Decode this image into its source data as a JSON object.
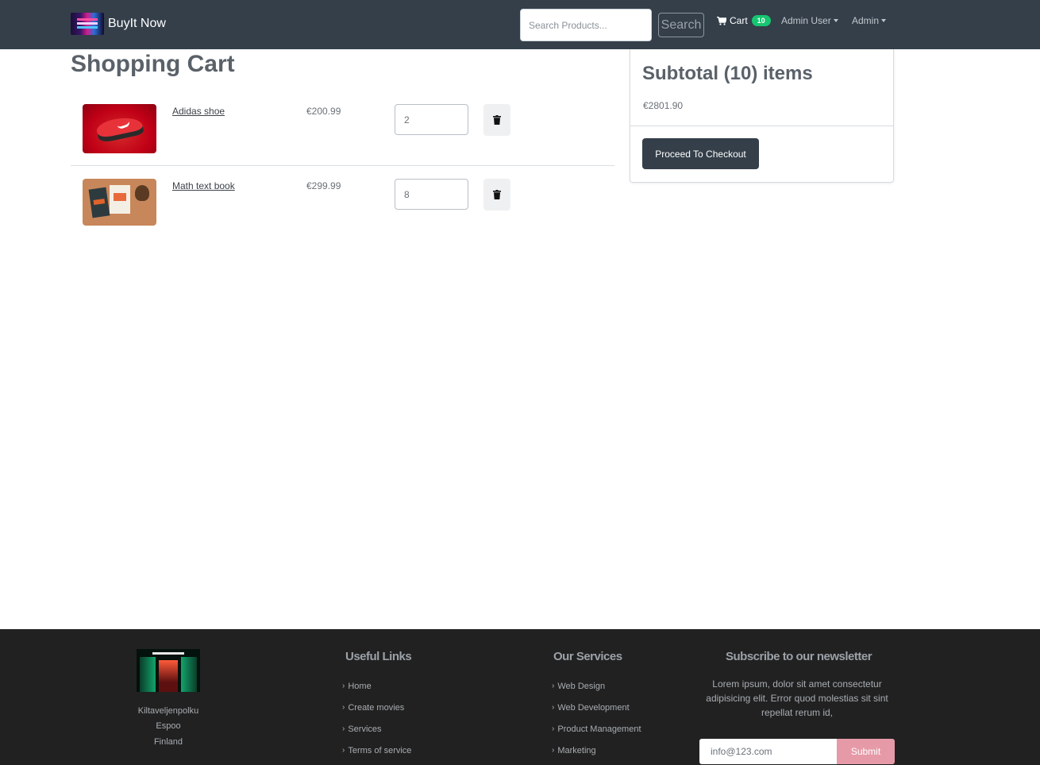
{
  "navbar": {
    "brand": "BuyIt Now",
    "search_placeholder": "Search Products...",
    "search_button": "Search",
    "cart_label": "Cart",
    "cart_count": "10",
    "user_menu": "Admin User",
    "admin_menu": "Admin"
  },
  "cart": {
    "title": "Shopping Cart",
    "items": [
      {
        "name": "Adidas shoe",
        "price": "€200.99",
        "quantity": "2",
        "image": "red-sneaker-photo"
      },
      {
        "name": "Math text book",
        "price": "€299.99",
        "quantity": "8",
        "image": "books-and-pinecone-photo"
      }
    ]
  },
  "summary": {
    "title": "Subtotal (10) items",
    "total": "€2801.90",
    "checkout_button": "Proceed To Checkout"
  },
  "footer": {
    "address": [
      "Kiltaveljenpolku",
      "Espoo",
      "Finland"
    ],
    "useful_links": {
      "heading": "Useful Links",
      "items": [
        "Home",
        "Create movies",
        "Services",
        "Terms of service"
      ]
    },
    "services": {
      "heading": "Our Services",
      "items": [
        "Web Design",
        "Web Development",
        "Product Management",
        "Marketing"
      ]
    },
    "newsletter": {
      "heading": "Subscribe to our newsletter",
      "text": "Lorem ipsum, dolor sit amet consectetur adipisicing elit. Error quod molestias sit sint repellat rerum id,",
      "email_value": "info@123.com",
      "submit": "Submit"
    }
  },
  "colors": {
    "navbar": "#343f4a",
    "badge": "#17c671",
    "footer": "#212121",
    "submit": "#e69aa8"
  }
}
